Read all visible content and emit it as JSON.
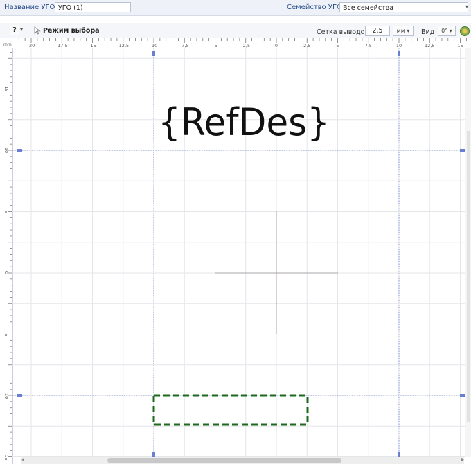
{
  "properties": {
    "ugo_name_label": "Название УГО",
    "ugo_name_value": "УГО (1)",
    "family_label": "Семейство УГО",
    "family_value": "Все семейства"
  },
  "toolbar": {
    "mode_label": "Режим выбора",
    "pin_grid_label": "Сетка выводов",
    "pin_grid_value": "2,5",
    "unit_value": "мм",
    "view_label": "Вид",
    "rotation_value": "0°"
  },
  "ruler": {
    "unit": "mm",
    "h_labels": [
      "-20",
      "-17,5",
      "-15",
      "-12,5",
      "-10",
      "-7,5",
      "-5",
      "-2,5",
      "0",
      "2,5",
      "5",
      "7,5",
      "10",
      "12,5",
      "15"
    ],
    "v_labels": [
      "15",
      "10",
      "5",
      "0",
      "-5",
      "-10",
      "-15"
    ]
  },
  "canvas": {
    "refdes_text": "{RefDes}"
  },
  "colors": {
    "grid": "#e4e6ea",
    "guide": "#6b7fd0",
    "cross": "#b3a0a5",
    "pin_box": "#1d6a1d",
    "ruler_tick": "#777777"
  }
}
